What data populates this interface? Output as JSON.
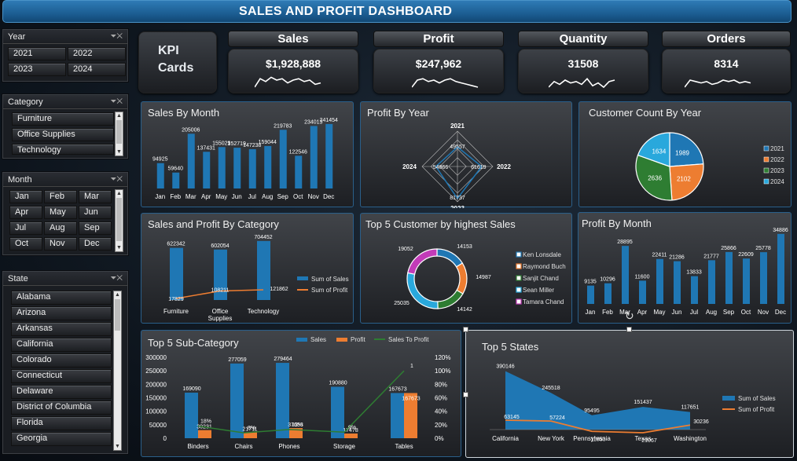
{
  "title": "SALES AND PROFIT DASHBOARD",
  "colors": {
    "blue": "#1f77b4",
    "orange": "#ed7d31",
    "green": "#2e7d32",
    "cyan": "#29a8dc",
    "magenta": "#c23bb8",
    "accent": "#2a5f8a"
  },
  "year_slicer": {
    "title": "Year",
    "items": [
      "2021",
      "2022",
      "2023",
      "2024"
    ]
  },
  "category_slicer": {
    "title": "Category",
    "items": [
      "Furniture",
      "Office Supplies",
      "Technology"
    ]
  },
  "month_slicer": {
    "title": "Month",
    "items": [
      "Jan",
      "Feb",
      "Mar",
      "Apr",
      "May",
      "Jun",
      "Jul",
      "Aug",
      "Sep",
      "Oct",
      "Nov",
      "Dec"
    ]
  },
  "state_slicer": {
    "title": "State",
    "items": [
      "Alabama",
      "Arizona",
      "Arkansas",
      "California",
      "Colorado",
      "Connecticut",
      "Delaware",
      "District of Columbia",
      "Florida",
      "Georgia"
    ]
  },
  "kpi": {
    "label_line1": "KPI",
    "label_line2": "Cards",
    "cards": [
      {
        "title": "Sales",
        "value": "$1,928,888"
      },
      {
        "title": "Profit",
        "value": "$247,962"
      },
      {
        "title": "Quantity",
        "value": "31508"
      },
      {
        "title": "Orders",
        "value": "8314"
      }
    ]
  },
  "chart_data": [
    {
      "id": "sales_by_month",
      "type": "bar",
      "title": "Sales By Month",
      "categories": [
        "Jan",
        "Feb",
        "Mar",
        "Apr",
        "May",
        "Jun",
        "Jul",
        "Aug",
        "Sep",
        "Oct",
        "Nov",
        "Dec"
      ],
      "values": [
        94925,
        59640,
        205006,
        137431,
        155029,
        152719,
        147238,
        159044,
        219783,
        122546,
        234013,
        241454
      ],
      "labels": [
        "94925",
        "59640",
        "205006",
        "137431",
        "155029",
        "152719",
        "147238",
        "159044",
        "219783",
        "122546",
        "234013",
        "241454"
      ]
    },
    {
      "id": "profit_by_year",
      "type": "radar",
      "title": "Profit By Year",
      "categories": [
        "2021",
        "2022",
        "2023",
        "2024"
      ],
      "values": [
        49557,
        61619,
        81737,
        54866
      ],
      "labels": [
        "49557",
        "61619",
        "81737",
        "54866"
      ]
    },
    {
      "id": "customer_count_by_year",
      "type": "pie",
      "title": "Customer Count By Year",
      "categories": [
        "2021",
        "2022",
        "2023",
        "2024"
      ],
      "values": [
        1989,
        2102,
        2636,
        1634
      ],
      "labels": [
        "1989",
        "2102",
        "2636",
        "1634"
      ]
    },
    {
      "id": "sales_profit_by_category",
      "type": "bar",
      "title": "Sales and Profit By Category",
      "categories": [
        "Furniture",
        "Office Supplies",
        "Technology"
      ],
      "category_lines": [
        [
          "Furniture"
        ],
        [
          "Office",
          "Supplies"
        ],
        [
          "Technology"
        ]
      ],
      "series": [
        {
          "name": "Sum of Sales",
          "values": [
            622342,
            602054,
            704452
          ],
          "labels": [
            "622342",
            "602054",
            "704452"
          ]
        },
        {
          "name": "Sum of Profit",
          "values": [
            17829,
            108211,
            121862
          ],
          "labels": [
            "17829",
            "108211",
            "121862"
          ]
        }
      ]
    },
    {
      "id": "top5_customers",
      "type": "pie",
      "title": "Top 5 Customer by highest Sales",
      "categories": [
        "Ken Lonsdale",
        "Raymond Buch",
        "Sanjit Chand",
        "Sean Miller",
        "Tamara Chand"
      ],
      "values": [
        14153,
        14987,
        14142,
        25035,
        19052
      ],
      "labels": [
        "14153",
        "14987",
        "14142",
        "25035",
        "19052"
      ]
    },
    {
      "id": "profit_by_month",
      "type": "bar",
      "title": "Profit By Month",
      "categories": [
        "Jan",
        "Feb",
        "Mar",
        "Apr",
        "May",
        "Jun",
        "Jul",
        "Aug",
        "Sep",
        "Oct",
        "Nov",
        "Dec"
      ],
      "values": [
        9135,
        10296,
        28895,
        11600,
        22411,
        21286,
        13833,
        21777,
        25866,
        22609,
        25778,
        34886
      ],
      "labels": [
        "9135",
        "10296",
        "28895",
        "11600",
        "22411",
        "21286",
        "13833",
        "21777",
        "25866",
        "22609",
        "25778",
        "34886"
      ]
    },
    {
      "id": "top5_subcategory",
      "type": "bar",
      "title": "Top 5 Sub-Category",
      "categories": [
        "Binders",
        "Chairs",
        "Phones",
        "Storage",
        "Tables"
      ],
      "series": [
        {
          "name": "Sales",
          "values": [
            169090,
            277059,
            279464,
            190880,
            167673
          ],
          "labels": [
            "169090",
            "277059",
            "279464",
            "190880",
            "167673"
          ]
        },
        {
          "name": "Profit",
          "values": [
            30231,
            21711,
            37653,
            17478,
            167673
          ],
          "labels": [
            "30231",
            "21711",
            "37653",
            "17478",
            "167673"
          ]
        },
        {
          "name": "Sales To Profit",
          "values": [
            0.18,
            0.08,
            0.13,
            0.09,
            1.0
          ],
          "labels": [
            "18%",
            "8%",
            "13%",
            "9%",
            "1"
          ]
        }
      ],
      "y_ticks": [
        "300000",
        "250000",
        "200000",
        "150000",
        "100000",
        "50000",
        "0"
      ],
      "y2_ticks": [
        "120%",
        "100%",
        "80%",
        "60%",
        "40%",
        "20%",
        "0%"
      ],
      "ylim": [
        0,
        300000
      ],
      "y2lim": [
        0,
        1.2
      ]
    },
    {
      "id": "top5_states",
      "type": "area",
      "title": "Top 5 States",
      "categories": [
        "California",
        "New York",
        "Pennsylvania",
        "Texas",
        "Washington"
      ],
      "series": [
        {
          "name": "Sum of Sales",
          "values": [
            390146,
            245518,
            95495,
            151437,
            117651
          ],
          "labels": [
            "390146",
            "245518",
            "95495",
            "151437",
            "117651"
          ]
        },
        {
          "name": "Sum of Profit",
          "values": [
            63145,
            57224,
            -11853,
            -21067,
            30236
          ],
          "labels": [
            "63145",
            "57224",
            "11853",
            "21067",
            "30236"
          ]
        }
      ]
    }
  ]
}
